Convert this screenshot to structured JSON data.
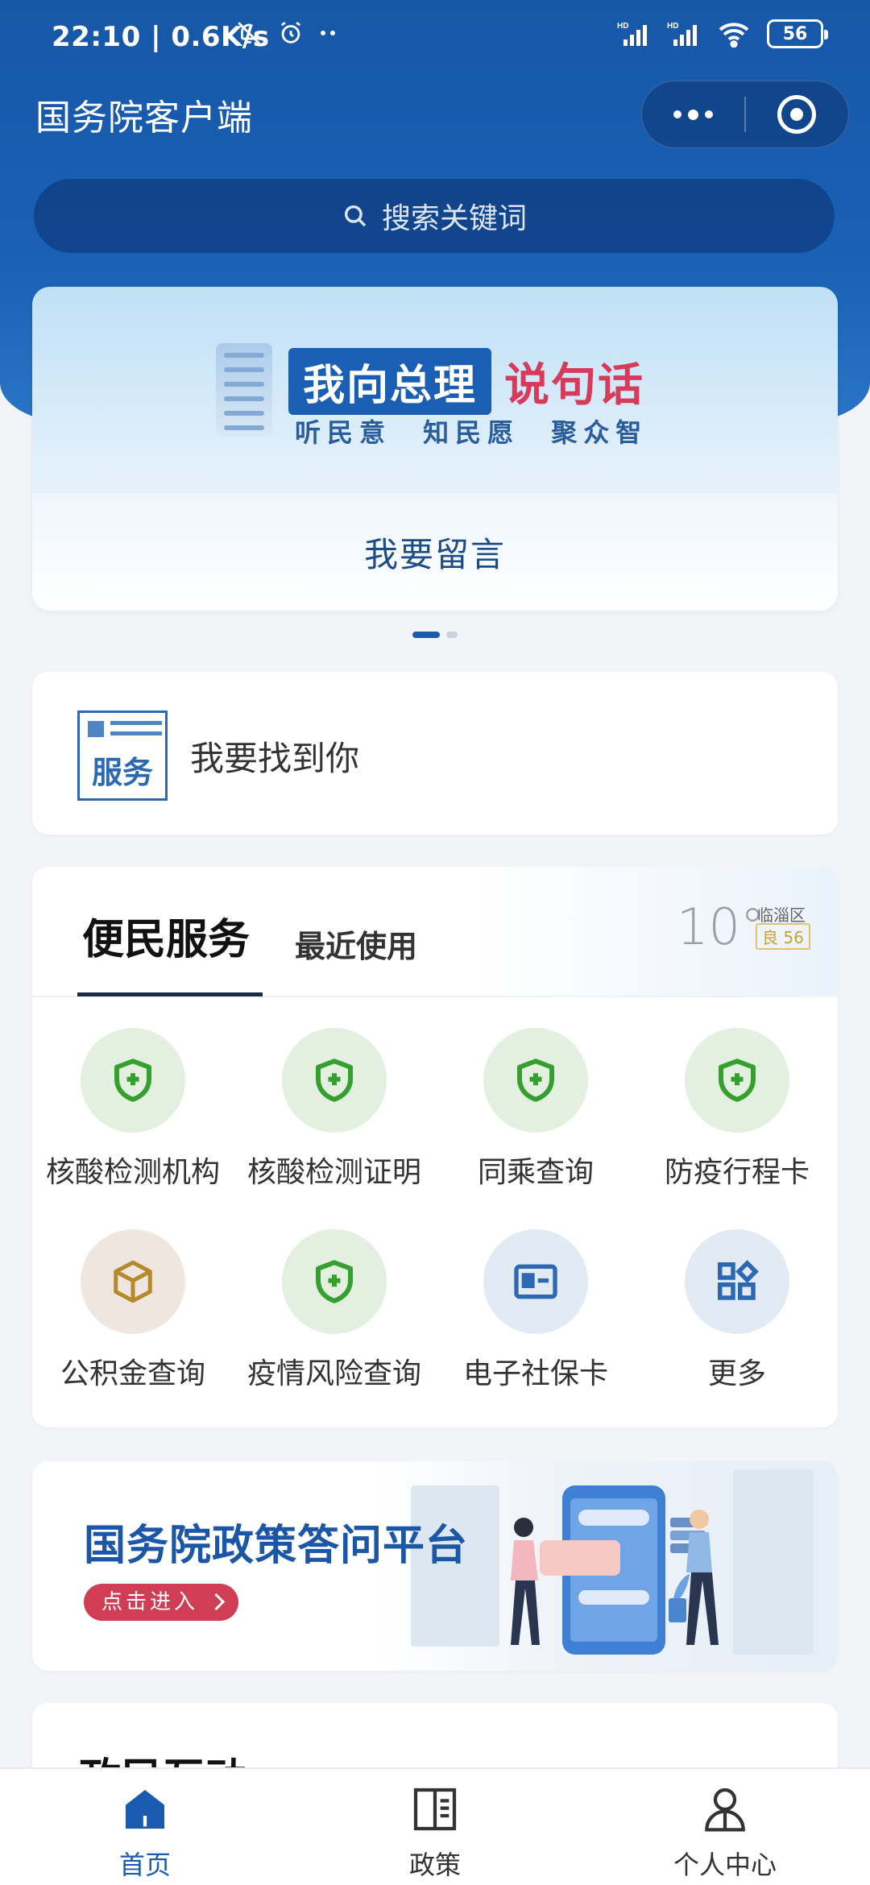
{
  "status_bar": {
    "time": "22:10 | 0.6K/s",
    "network_label": "HD",
    "battery": "56"
  },
  "header": {
    "app_title": "国务院客户端"
  },
  "search": {
    "placeholder": "搜索关键词"
  },
  "banner": {
    "title_box": "我向总理",
    "title_red": "说句话",
    "subtitle": "听民意 知民愿 聚众智",
    "action": "我要留言",
    "page_count": 2,
    "active_page": 1
  },
  "find_card": {
    "badge_text": "服务",
    "label": "我要找到你"
  },
  "services": {
    "tabs": [
      "便民服务",
      "最近使用"
    ],
    "weather": {
      "temperature": "10°",
      "area": "临淄区",
      "aqi": "良 56"
    },
    "items": [
      {
        "label": "核酸检测机构",
        "icon": "shield-plus-icon"
      },
      {
        "label": "核酸检测证明",
        "icon": "shield-plus-icon"
      },
      {
        "label": "同乘查询",
        "icon": "shield-plus-icon"
      },
      {
        "label": "防疫行程卡",
        "icon": "shield-plus-icon"
      },
      {
        "label": "公积金查询",
        "icon": "box-icon"
      },
      {
        "label": "疫情风险查询",
        "icon": "shield-plus-icon"
      },
      {
        "label": "电子社保卡",
        "icon": "id-card-icon"
      },
      {
        "label": "更多",
        "icon": "grid-more-icon"
      }
    ]
  },
  "policy_banner": {
    "title": "国务院政策答问平台",
    "button": "点击进入"
  },
  "interaction": {
    "title": "政民互动"
  },
  "bottom_nav": {
    "items": [
      "首页",
      "政策",
      "个人中心"
    ],
    "active": "首页"
  },
  "colors": {
    "header_blue": "#1757a8",
    "accent_blue": "#1a5bb0",
    "shield_green": "#35a02f",
    "accent_red": "#cf3e55"
  }
}
